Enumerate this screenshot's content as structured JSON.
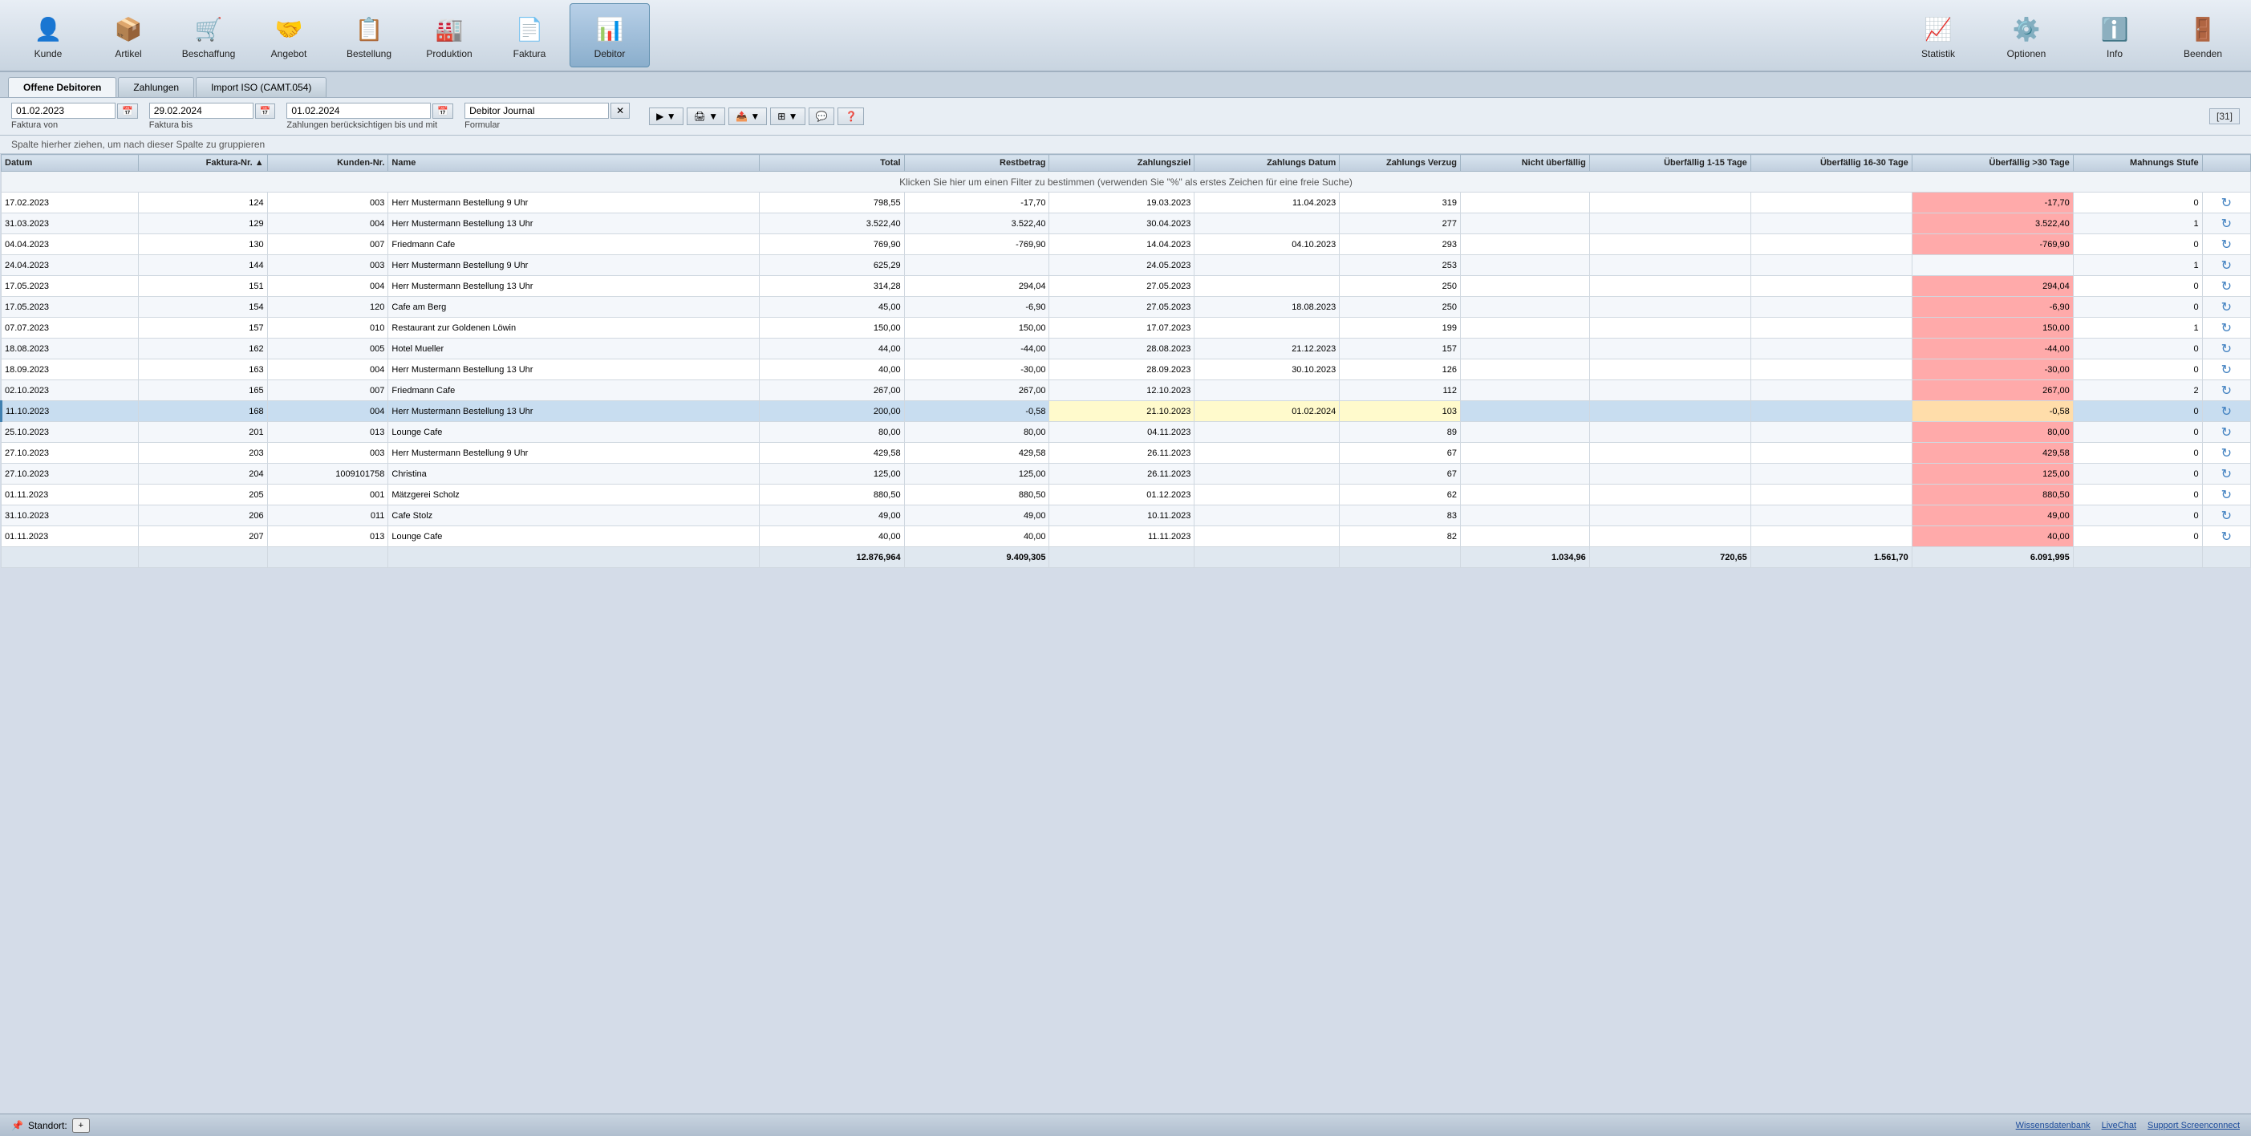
{
  "toolbar": {
    "items": [
      {
        "id": "kunde",
        "label": "Kunde",
        "icon": "👤",
        "active": false
      },
      {
        "id": "artikel",
        "label": "Artikel",
        "icon": "📦",
        "active": false
      },
      {
        "id": "beschaffung",
        "label": "Beschaffung",
        "icon": "🛒",
        "active": false
      },
      {
        "id": "angebot",
        "label": "Angebot",
        "icon": "🤝",
        "active": false
      },
      {
        "id": "bestellung",
        "label": "Bestellung",
        "icon": "📋",
        "active": false
      },
      {
        "id": "produktion",
        "label": "Produktion",
        "icon": "🏭",
        "active": false
      },
      {
        "id": "faktura",
        "label": "Faktura",
        "icon": "📄",
        "active": false
      },
      {
        "id": "debitor",
        "label": "Debitor",
        "icon": "📊",
        "active": true
      }
    ],
    "right_items": [
      {
        "id": "statistik",
        "label": "Statistik",
        "icon": "📈"
      },
      {
        "id": "optionen",
        "label": "Optionen",
        "icon": "⚙️"
      },
      {
        "id": "info",
        "label": "Info",
        "icon": "ℹ️"
      },
      {
        "id": "beenden",
        "label": "Beenden",
        "icon": "🚪"
      }
    ]
  },
  "tabs": [
    {
      "id": "offene-debitoren",
      "label": "Offene Debitoren",
      "active": true
    },
    {
      "id": "zahlungen",
      "label": "Zahlungen",
      "active": false
    },
    {
      "id": "import-iso",
      "label": "Import ISO (CAMT.054)",
      "active": false
    }
  ],
  "filter": {
    "faktura_von_value": "01.02.2023",
    "faktura_von_label": "Faktura von",
    "faktura_bis_value": "29.02.2024",
    "faktura_bis_label": "Faktura bis",
    "zahlungen_bis_value": "01.02.2024",
    "zahlungen_bis_label": "Zahlungen berücksichtigen bis und mit",
    "formular_value": "Debitor Journal",
    "formular_label": "Formular"
  },
  "group_hint": "Spalte hierher ziehen, um nach dieser Spalte zu gruppieren",
  "filter_row_hint": "Klicken Sie hier um einen Filter zu bestimmen (verwenden Sie \"%\" als erstes Zeichen für eine freie Suche)",
  "record_count": "[31]",
  "columns": [
    {
      "id": "datum",
      "label": "Datum",
      "align": "left"
    },
    {
      "id": "faktura-nr",
      "label": "Faktura-Nr.",
      "align": "right",
      "sort": "asc"
    },
    {
      "id": "kunden-nr",
      "label": "Kunden-Nr.",
      "align": "right"
    },
    {
      "id": "name",
      "label": "Name",
      "align": "left"
    },
    {
      "id": "total",
      "label": "Total",
      "align": "right"
    },
    {
      "id": "restbetrag",
      "label": "Restbetrag",
      "align": "right"
    },
    {
      "id": "zahlungsziel",
      "label": "Zahlungsziel",
      "align": "right"
    },
    {
      "id": "zahlungs-datum",
      "label": "Zahlungs Datum",
      "align": "right"
    },
    {
      "id": "zahlungs-verzug",
      "label": "Zahlungs Verzug",
      "align": "right"
    },
    {
      "id": "nicht-ueberfaellig",
      "label": "Nicht überfällig",
      "align": "right"
    },
    {
      "id": "ueberfaellig-1-15",
      "label": "Überfällig 1-15 Tage",
      "align": "right"
    },
    {
      "id": "ueberfaellig-16-30",
      "label": "Überfällig 16-30 Tage",
      "align": "right"
    },
    {
      "id": "ueberfaellig-30",
      "label": "Überfällig >30 Tage",
      "align": "right"
    },
    {
      "id": "mahnung",
      "label": "Mahnungs Stufe",
      "align": "right"
    },
    {
      "id": "action",
      "label": "",
      "align": "center"
    }
  ],
  "rows": [
    {
      "datum": "17.02.2023",
      "faktura": "124",
      "kunden": "003",
      "name": "Herr Mustermann Bestellung 9 Uhr",
      "total": "798,55",
      "restbetrag": "-17,70",
      "zahlungsziel": "19.03.2023",
      "zdatum": "11.04.2023",
      "zverzug": "319",
      "nicht": "",
      "ue115": "",
      "ue1630": "",
      "ue30": "-17,70",
      "mahnung": "0",
      "selected": false,
      "ue30_color": "red"
    },
    {
      "datum": "31.03.2023",
      "faktura": "129",
      "kunden": "004",
      "name": "Herr Mustermann Bestellung 13 Uhr",
      "total": "3.522,40",
      "restbetrag": "3.522,40",
      "zahlungsziel": "30.04.2023",
      "zdatum": "",
      "zverzug": "277",
      "nicht": "",
      "ue115": "",
      "ue1630": "",
      "ue30": "3.522,40",
      "mahnung": "1",
      "selected": false,
      "ue30_color": "red"
    },
    {
      "datum": "04.04.2023",
      "faktura": "130",
      "kunden": "007",
      "name": "Friedmann Cafe",
      "total": "769,90",
      "restbetrag": "-769,90",
      "zahlungsziel": "14.04.2023",
      "zdatum": "04.10.2023",
      "zverzug": "293",
      "nicht": "",
      "ue115": "",
      "ue1630": "",
      "ue30": "-769,90",
      "mahnung": "0",
      "selected": false,
      "ue30_color": "red"
    },
    {
      "datum": "24.04.2023",
      "faktura": "144",
      "kunden": "003",
      "name": "Herr Mustermann Bestellung 9 Uhr",
      "total": "625,29",
      "restbetrag": "",
      "zahlungsziel": "24.05.2023",
      "zdatum": "",
      "zverzug": "253",
      "nicht": "",
      "ue115": "",
      "ue1630": "",
      "ue30": "",
      "mahnung": "1",
      "selected": false,
      "ue30_color": ""
    },
    {
      "datum": "17.05.2023",
      "faktura": "151",
      "kunden": "004",
      "name": "Herr Mustermann Bestellung 13 Uhr",
      "total": "314,28",
      "restbetrag": "294,04",
      "zahlungsziel": "27.05.2023",
      "zdatum": "",
      "zverzug": "250",
      "nicht": "",
      "ue115": "",
      "ue1630": "",
      "ue30": "294,04",
      "mahnung": "0",
      "selected": false,
      "ue30_color": "red"
    },
    {
      "datum": "17.05.2023",
      "faktura": "154",
      "kunden": "120",
      "name": "Cafe am Berg",
      "total": "45,00",
      "restbetrag": "-6,90",
      "zahlungsziel": "27.05.2023",
      "zdatum": "18.08.2023",
      "zverzug": "250",
      "nicht": "",
      "ue115": "",
      "ue1630": "",
      "ue30": "-6,90",
      "mahnung": "0",
      "selected": false,
      "ue30_color": "red"
    },
    {
      "datum": "07.07.2023",
      "faktura": "157",
      "kunden": "010",
      "name": "Restaurant zur Goldenen Löwin",
      "total": "150,00",
      "restbetrag": "150,00",
      "zahlungsziel": "17.07.2023",
      "zdatum": "",
      "zverzug": "199",
      "nicht": "",
      "ue115": "",
      "ue1630": "",
      "ue30": "150,00",
      "mahnung": "1",
      "selected": false,
      "ue30_color": "red"
    },
    {
      "datum": "18.08.2023",
      "faktura": "162",
      "kunden": "005",
      "name": "Hotel Mueller",
      "total": "44,00",
      "restbetrag": "-44,00",
      "zahlungsziel": "28.08.2023",
      "zdatum": "21.12.2023",
      "zverzug": "157",
      "nicht": "",
      "ue115": "",
      "ue1630": "",
      "ue30": "-44,00",
      "mahnung": "0",
      "selected": false,
      "ue30_color": "red"
    },
    {
      "datum": "18.09.2023",
      "faktura": "163",
      "kunden": "004",
      "name": "Herr Mustermann Bestellung 13 Uhr",
      "total": "40,00",
      "restbetrag": "-30,00",
      "zahlungsziel": "28.09.2023",
      "zdatum": "30.10.2023",
      "zverzug": "126",
      "nicht": "",
      "ue115": "",
      "ue1630": "",
      "ue30": "-30,00",
      "mahnung": "0",
      "selected": false,
      "ue30_color": "red"
    },
    {
      "datum": "02.10.2023",
      "faktura": "165",
      "kunden": "007",
      "name": "Friedmann Cafe",
      "total": "267,00",
      "restbetrag": "267,00",
      "zahlungsziel": "12.10.2023",
      "zdatum": "",
      "zverzug": "112",
      "nicht": "",
      "ue115": "",
      "ue1630": "",
      "ue30": "267,00",
      "mahnung": "2",
      "selected": false,
      "ue30_color": "red"
    },
    {
      "datum": "11.10.2023",
      "faktura": "168",
      "kunden": "004",
      "name": "Herr Mustermann Bestellung 13 Uhr",
      "total": "200,00",
      "restbetrag": "-0,58",
      "zahlungsziel": "21.10.2023",
      "zdatum": "01.02.2024",
      "zverzug": "103",
      "nicht": "",
      "ue115": "",
      "ue1630": "",
      "ue30": "-0,58",
      "mahnung": "0",
      "selected": true,
      "ue30_color": "orange"
    },
    {
      "datum": "25.10.2023",
      "faktura": "201",
      "kunden": "013",
      "name": "Lounge Cafe",
      "total": "80,00",
      "restbetrag": "80,00",
      "zahlungsziel": "04.11.2023",
      "zdatum": "",
      "zverzug": "89",
      "nicht": "",
      "ue115": "",
      "ue1630": "",
      "ue30": "80,00",
      "mahnung": "0",
      "selected": false,
      "ue30_color": "red"
    },
    {
      "datum": "27.10.2023",
      "faktura": "203",
      "kunden": "003",
      "name": "Herr Mustermann Bestellung 9 Uhr",
      "total": "429,58",
      "restbetrag": "429,58",
      "zahlungsziel": "26.11.2023",
      "zdatum": "",
      "zverzug": "67",
      "nicht": "",
      "ue115": "",
      "ue1630": "",
      "ue30": "429,58",
      "mahnung": "0",
      "selected": false,
      "ue30_color": "red"
    },
    {
      "datum": "27.10.2023",
      "faktura": "204",
      "kunden": "1009101758",
      "name": "Christina",
      "total": "125,00",
      "restbetrag": "125,00",
      "zahlungsziel": "26.11.2023",
      "zdatum": "",
      "zverzug": "67",
      "nicht": "",
      "ue115": "",
      "ue1630": "",
      "ue30": "125,00",
      "mahnung": "0",
      "selected": false,
      "ue30_color": "red"
    },
    {
      "datum": "01.11.2023",
      "faktura": "205",
      "kunden": "001",
      "name": "Mätzgerei Scholz",
      "total": "880,50",
      "restbetrag": "880,50",
      "zahlungsziel": "01.12.2023",
      "zdatum": "",
      "zverzug": "62",
      "nicht": "",
      "ue115": "",
      "ue1630": "",
      "ue30": "880,50",
      "mahnung": "0",
      "selected": false,
      "ue30_color": "red"
    },
    {
      "datum": "31.10.2023",
      "faktura": "206",
      "kunden": "011",
      "name": "Cafe Stolz",
      "total": "49,00",
      "restbetrag": "49,00",
      "zahlungsziel": "10.11.2023",
      "zdatum": "",
      "zverzug": "83",
      "nicht": "",
      "ue115": "",
      "ue1630": "",
      "ue30": "49,00",
      "mahnung": "0",
      "selected": false,
      "ue30_color": "red"
    },
    {
      "datum": "01.11.2023",
      "faktura": "207",
      "kunden": "013",
      "name": "Lounge Cafe",
      "total": "40,00",
      "restbetrag": "40,00",
      "zahlungsziel": "11.11.2023",
      "zdatum": "",
      "zverzug": "82",
      "nicht": "",
      "ue115": "",
      "ue1630": "",
      "ue30": "40,00",
      "mahnung": "0",
      "selected": false,
      "ue30_color": "red"
    }
  ],
  "totals": {
    "total": "12.876,964",
    "restbetrag": "9.409,305",
    "nicht": "1.034,96",
    "ue115": "720,65",
    "ue1630": "1.561,70",
    "ue30": "6.091,995"
  },
  "status_bar": {
    "standort_label": "Standort:",
    "standort_icon": "📌",
    "links": [
      {
        "id": "wissensdatenbank",
        "label": "Wissensdatenbank"
      },
      {
        "id": "livechat",
        "label": "LiveChat"
      },
      {
        "id": "support",
        "label": "Support Screenconnect"
      }
    ]
  }
}
